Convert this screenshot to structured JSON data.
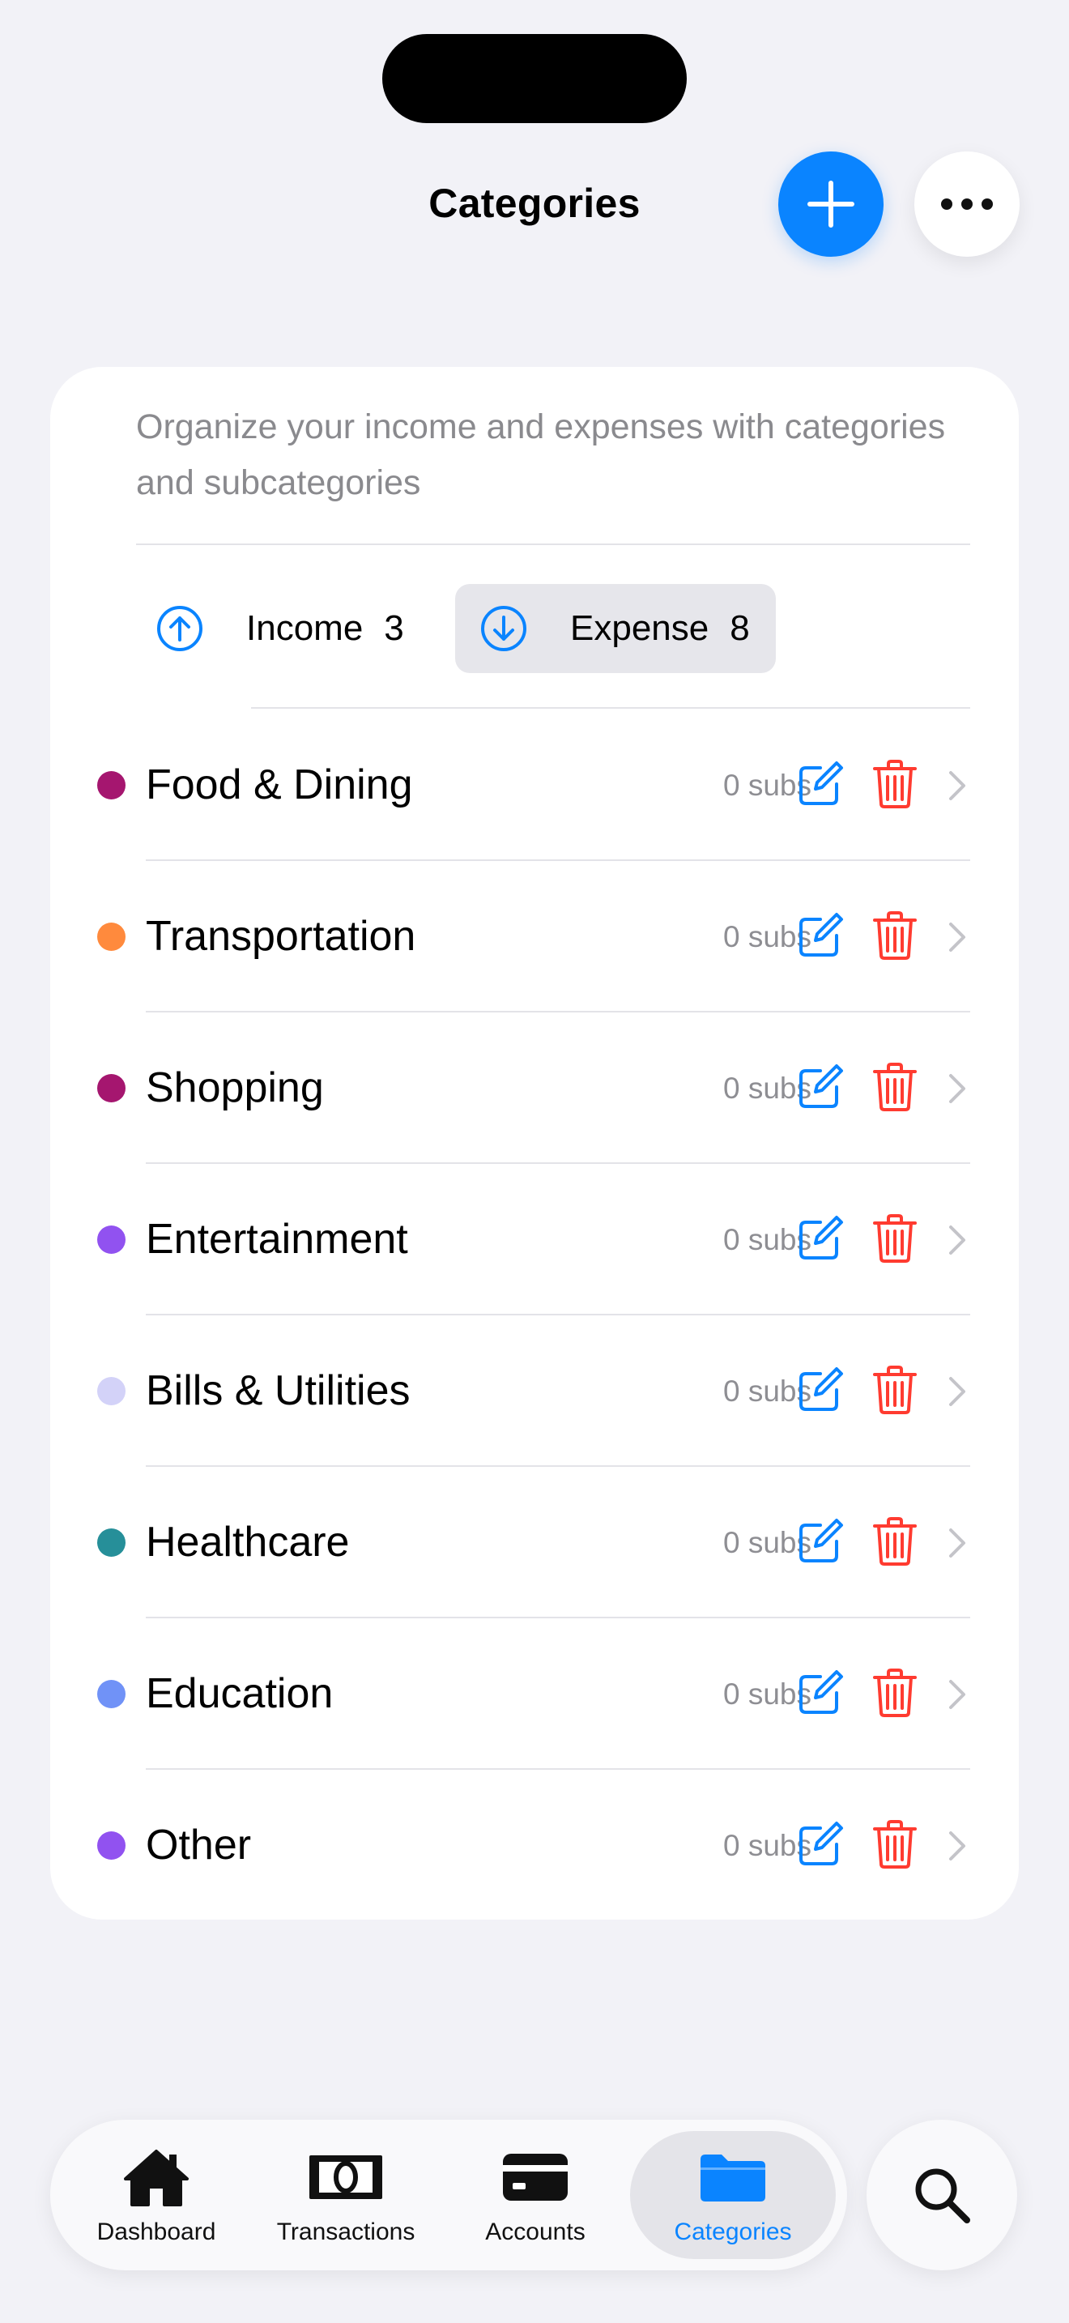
{
  "header": {
    "title": "Categories",
    "add_icon": "plus-icon",
    "more_icon": "ellipsis-icon"
  },
  "description": "Organize your income and expenses with categories and subcategories",
  "segments": {
    "income": {
      "label": "Income",
      "count": "3",
      "icon": "arrow-up-circle-icon"
    },
    "expense": {
      "label": "Expense",
      "count": "8",
      "icon": "arrow-down-circle-icon",
      "selected": true
    }
  },
  "categories": [
    {
      "name": "Food & Dining",
      "subs": "0 subs",
      "color": "#A5166F"
    },
    {
      "name": "Transportation",
      "subs": "0 subs",
      "color": "#FF8A3D"
    },
    {
      "name": "Shopping",
      "subs": "0 subs",
      "color": "#A5166F"
    },
    {
      "name": "Entertainment",
      "subs": "0 subs",
      "color": "#9152F0"
    },
    {
      "name": "Bills & Utilities",
      "subs": "0 subs",
      "color": "#D3D2F8"
    },
    {
      "name": "Healthcare",
      "subs": "0 subs",
      "color": "#268F99"
    },
    {
      "name": "Education",
      "subs": "0 subs",
      "color": "#7092F7"
    },
    {
      "name": "Other",
      "subs": "0 subs",
      "color": "#9152F0"
    }
  ],
  "row_icons": {
    "edit": "edit-icon",
    "delete": "trash-icon",
    "disclosure": "chevron-right-icon"
  },
  "tabbar": {
    "tabs": [
      {
        "label": "Dashboard",
        "icon": "house-icon"
      },
      {
        "label": "Transactions",
        "icon": "banknote-icon"
      },
      {
        "label": "Accounts",
        "icon": "card-icon"
      },
      {
        "label": "Categories",
        "icon": "folder-icon",
        "active": true
      }
    ],
    "search_icon": "search-icon"
  },
  "colors": {
    "accent": "#0A84FF",
    "destructive": "#FF3B30",
    "background": "#F2F2F7"
  }
}
